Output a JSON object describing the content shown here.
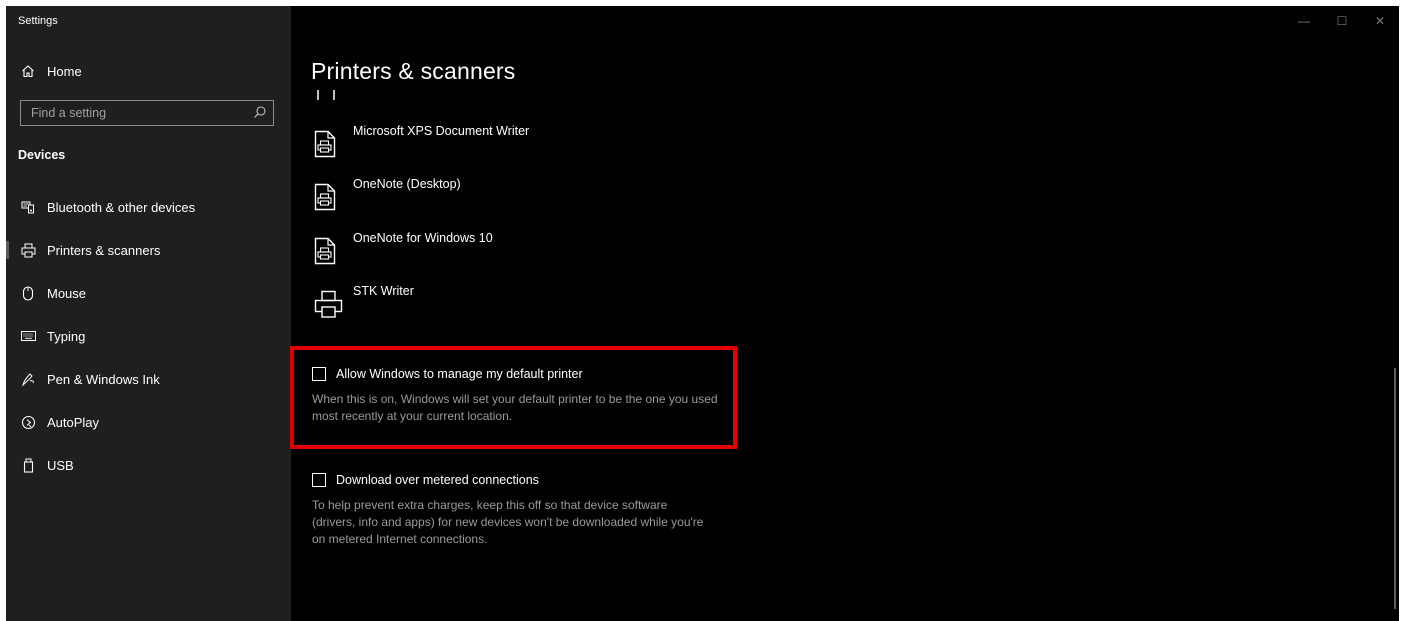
{
  "app_title": "Settings",
  "window_controls": {
    "minimize": "—",
    "maximize": "☐",
    "close": "✕"
  },
  "sidebar": {
    "home_label": "Home",
    "search_placeholder": "Find a setting",
    "section_heading": "Devices",
    "items": [
      {
        "label": "Bluetooth & other devices",
        "icon": "bluetooth-devices-icon"
      },
      {
        "label": "Printers & scanners",
        "icon": "printer-icon",
        "active": true
      },
      {
        "label": "Mouse",
        "icon": "mouse-icon"
      },
      {
        "label": "Typing",
        "icon": "keyboard-icon"
      },
      {
        "label": "Pen & Windows Ink",
        "icon": "pen-icon"
      },
      {
        "label": "AutoPlay",
        "icon": "autoplay-icon"
      },
      {
        "label": "USB",
        "icon": "usb-icon"
      }
    ]
  },
  "main": {
    "title": "Printers & scanners",
    "printers": [
      {
        "name": "Microsoft XPS Document Writer",
        "icon": "document-printer-icon"
      },
      {
        "name": "OneNote (Desktop)",
        "icon": "document-printer-icon"
      },
      {
        "name": "OneNote for Windows 10",
        "icon": "document-printer-icon"
      },
      {
        "name": "STK Writer",
        "icon": "printer-icon"
      }
    ],
    "options": [
      {
        "label": "Allow Windows to manage my default printer",
        "checked": false,
        "description": "When this is on, Windows will set your default printer to be the one you used most recently at your current location."
      },
      {
        "label": "Download over metered connections",
        "checked": false,
        "description": "To help prevent extra charges, keep this off so that device software (drivers, info and apps) for new devices won't be downloaded while you're on metered Internet connections."
      }
    ]
  },
  "colors": {
    "sidebar_bg": "#1f1f1f",
    "main_bg": "#000000",
    "highlight": "#e00000",
    "description_text": "#9a9a9a"
  }
}
